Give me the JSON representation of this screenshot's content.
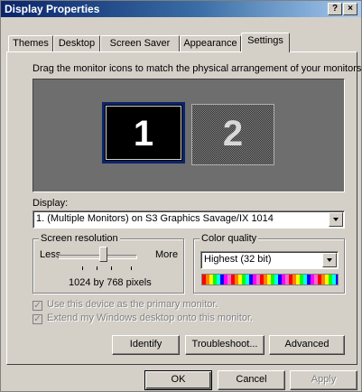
{
  "window": {
    "title": "Display Properties",
    "help_button": "?",
    "close_button": "×"
  },
  "tabs": [
    {
      "label": "Themes",
      "active": false
    },
    {
      "label": "Desktop",
      "active": false
    },
    {
      "label": "Screen Saver",
      "active": false
    },
    {
      "label": "Appearance",
      "active": false
    },
    {
      "label": "Settings",
      "active": true
    }
  ],
  "settings": {
    "instruction": "Drag the monitor icons to match the physical arrangement of your monitors.",
    "monitors": [
      {
        "number": "1",
        "selected": true
      },
      {
        "number": "2",
        "selected": false
      }
    ],
    "display_label": "Display:",
    "display_value": "1. (Multiple Monitors) on S3 Graphics Savage/IX 1014",
    "screen_resolution": {
      "group_label": "Screen resolution",
      "less_label": "Less",
      "more_label": "More",
      "value_text": "1024 by 768 pixels",
      "slider_fraction": 0.58
    },
    "color_quality": {
      "group_label": "Color quality",
      "selected": "Highest (32 bit)"
    },
    "checkboxes": [
      {
        "label": "Use this device as the primary monitor.",
        "checked": true,
        "disabled": true
      },
      {
        "label": "Extend my Windows desktop onto this monitor.",
        "checked": true,
        "disabled": true
      }
    ],
    "buttons": {
      "identify": "Identify",
      "troubleshoot": "Troubleshoot...",
      "advanced": "Advanced"
    }
  },
  "footer": {
    "ok": "OK",
    "cancel": "Cancel",
    "apply": "Apply"
  },
  "colors": {
    "titlebar_start": "#0a246a",
    "face": "#d4d0c8",
    "monitor_area": "#6e6e6e"
  }
}
